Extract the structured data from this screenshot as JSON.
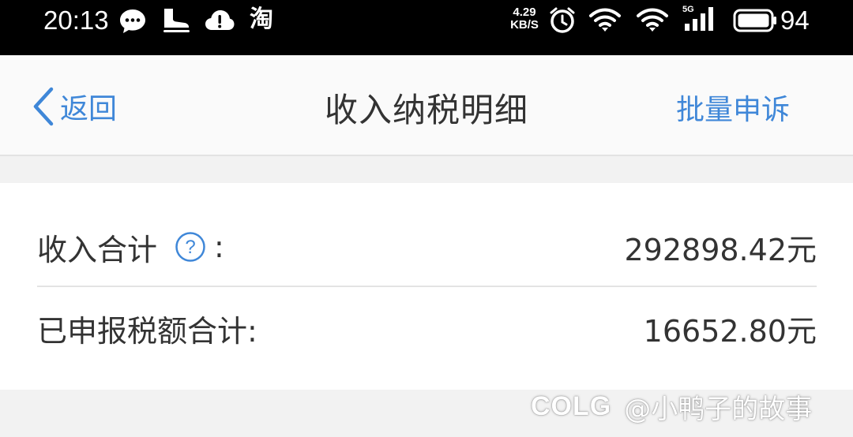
{
  "status_bar": {
    "time": "20:13",
    "net_speed_value": "4.29",
    "net_speed_unit": "KB/S",
    "battery": "94",
    "icons": [
      "chat-bubble-icon",
      "skate-icon",
      "cloud-alert-icon",
      "taobao-icon",
      "alarm-icon",
      "wifi-icon",
      "wifi-icon",
      "signal-5g-icon",
      "battery-icon"
    ],
    "taobao_glyph": "淘",
    "signal_tag": "5G"
  },
  "nav": {
    "back_label": "返回",
    "title": "收入纳税明细",
    "action_label": "批量申诉",
    "accent": "#3f87d8"
  },
  "summary": {
    "income_label": "收入合计",
    "income_colon": ":",
    "income_value": "292898.42元",
    "tax_label": "已申报税额合计:",
    "tax_value": "16652.80元",
    "help_glyph": "?"
  },
  "watermark": {
    "logo": "COLG",
    "text": "@小鸭子的故事"
  }
}
